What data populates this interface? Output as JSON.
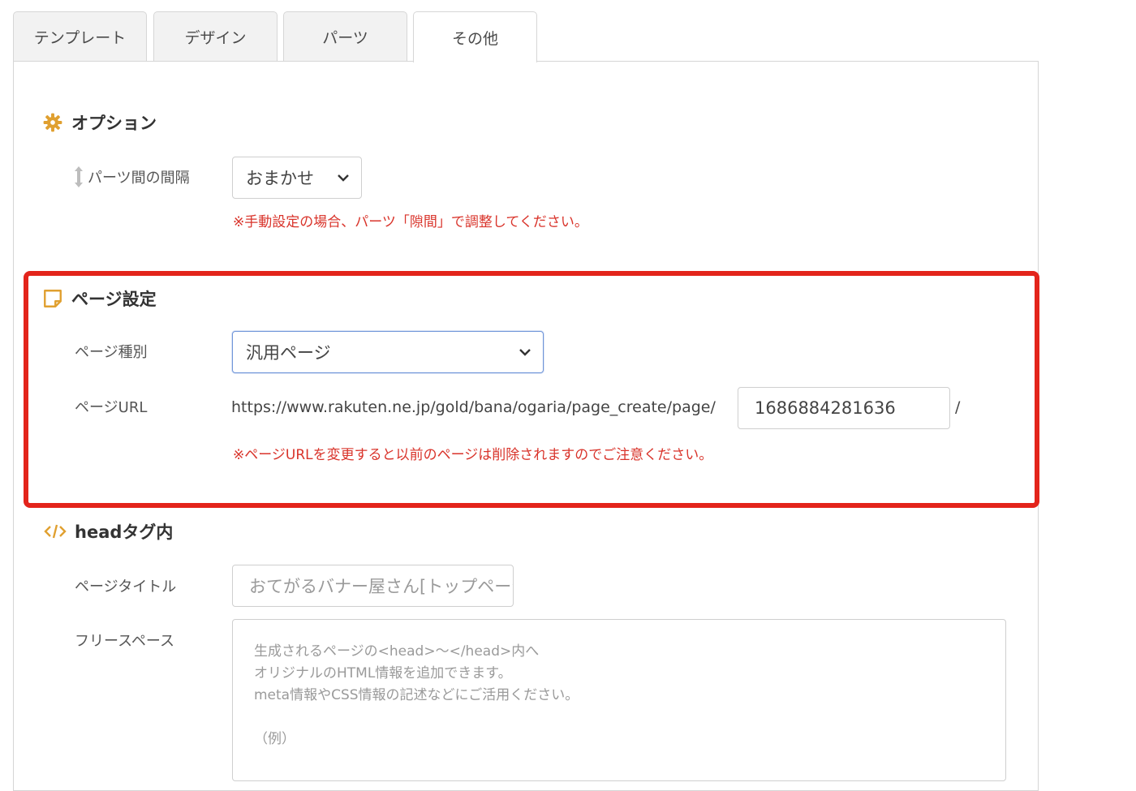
{
  "tabs": [
    {
      "label": "テンプレート",
      "active": false
    },
    {
      "label": "デザイン",
      "active": false
    },
    {
      "label": "パーツ",
      "active": false
    },
    {
      "label": "その他",
      "active": true
    }
  ],
  "options": {
    "title": "オプション",
    "icon": "gear-icon",
    "spacing_label": "パーツ間の間隔",
    "spacing_icon": "vertical-arrows-icon",
    "spacing_value": "おまかせ",
    "spacing_note": "※手動設定の場合、パーツ「隙間」で調整してください。"
  },
  "page_settings": {
    "title": "ページ設定",
    "icon": "note-icon",
    "type_label": "ページ種別",
    "type_value": "汎用ページ",
    "url_label": "ページURL",
    "url_prefix": "https://www.rakuten.ne.jp/gold/bana/ogaria/page_create/page/",
    "url_value": "1686884281636",
    "url_suffix": "/",
    "url_note": "※ページURLを変更すると以前のページは削除されますのでご注意ください。"
  },
  "head_section": {
    "title": "headタグ内",
    "icon": "code-icon",
    "page_title_label": "ページタイトル",
    "page_title_placeholder": "おてがるバナー屋さん[トップページ]",
    "free_space_label": "フリースペース",
    "free_space_lines": [
      "生成されるページの<head>〜</head>内へ",
      "オリジナルのHTML情報を追加できます。",
      "meta情報やCSS情報の記述などにご活用ください。",
      "",
      "（例）"
    ]
  },
  "colors": {
    "accent_icon": "#e0a030",
    "note_red": "#d9342b",
    "highlight_red": "#e3241b",
    "focus_blue": "#6f95d9"
  }
}
